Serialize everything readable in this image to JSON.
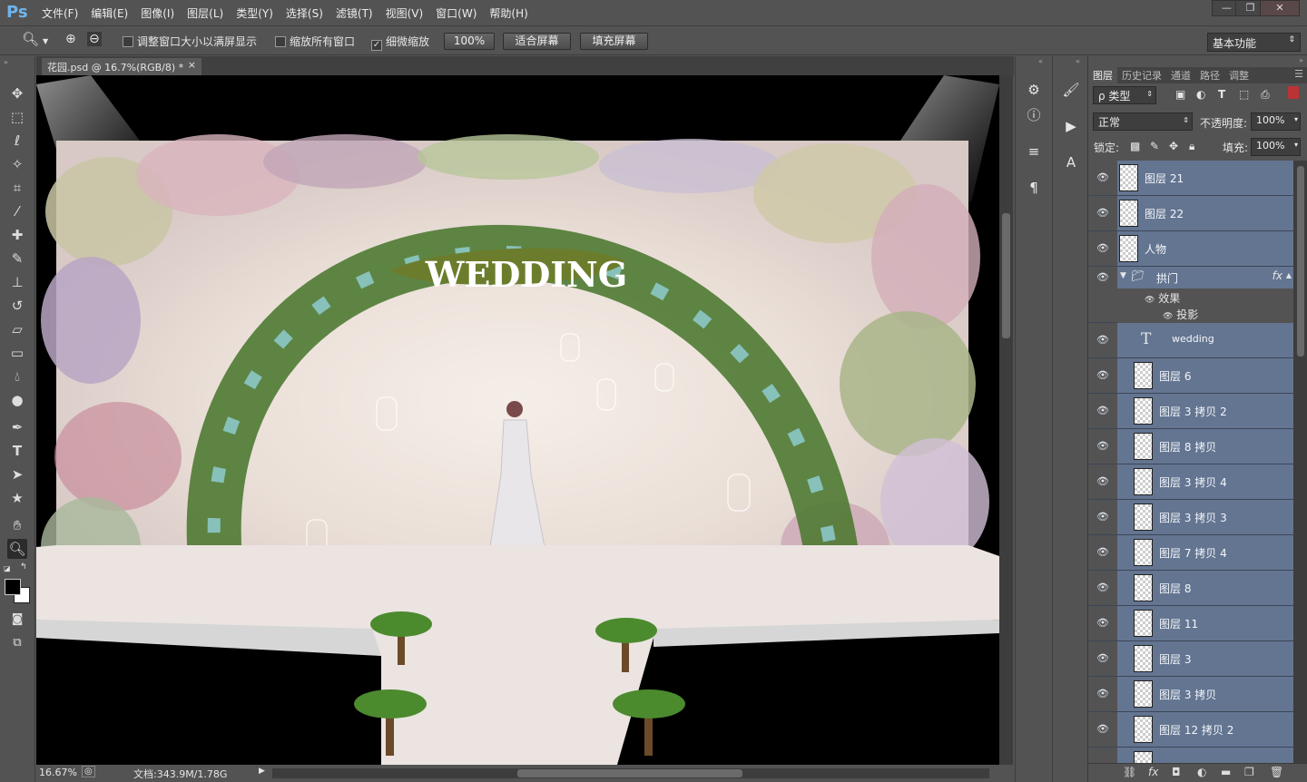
{
  "app": {
    "logo": "Ps"
  },
  "menu": [
    "文件(F)",
    "编辑(E)",
    "图像(I)",
    "图层(L)",
    "类型(Y)",
    "选择(S)",
    "滤镜(T)",
    "视图(V)",
    "窗口(W)",
    "帮助(H)"
  ],
  "window_controls": [
    "—",
    "❐",
    "✕"
  ],
  "options": {
    "resize_windows": "调整窗口大小以满屏显示",
    "zoom_all": "缩放所有窗口",
    "scrubby_zoom": "细微缩放",
    "zoom_value": "100%",
    "fit_screen": "适合屏幕",
    "fill_screen": "填充屏幕",
    "workspace": "基本功能"
  },
  "document": {
    "tab_title": "花园.psd @ 16.7%(RGB/8) *",
    "close": "×",
    "canvas_title": "WEDDING"
  },
  "status": {
    "zoom": "16.67%",
    "doc_info": "文档:343.9M/1.78G"
  },
  "panel": {
    "tabs": [
      "图层",
      "历史记录",
      "通道",
      "路径",
      "调整"
    ],
    "filter_kind": "ρ 类型",
    "blend_mode": "正常",
    "opacity_label": "不透明度:",
    "opacity_value": "100%",
    "lock_label": "锁定:",
    "fill_label": "填充:",
    "fill_value": "100%",
    "effects_label": "效果",
    "drop_shadow_label": "投影",
    "group_fx": "fx",
    "layers": [
      {
        "name": "图层 21",
        "kind": "pixel",
        "indent": 0
      },
      {
        "name": "图层 22",
        "kind": "pixel",
        "indent": 0
      },
      {
        "name": "人物",
        "kind": "pixel",
        "indent": 0
      },
      {
        "name": "拱门",
        "kind": "group",
        "indent": 0
      },
      {
        "name": "wedding",
        "kind": "text",
        "indent": 1
      },
      {
        "name": "图层 6",
        "kind": "pixel",
        "indent": 1
      },
      {
        "name": "图层 3 拷贝 2",
        "kind": "pixel",
        "indent": 1
      },
      {
        "name": "图层 8 拷贝",
        "kind": "pixel",
        "indent": 1
      },
      {
        "name": "图层 3 拷贝 4",
        "kind": "pixel",
        "indent": 1
      },
      {
        "name": "图层 3 拷贝 3",
        "kind": "pixel",
        "indent": 1
      },
      {
        "name": "图层 7 拷贝 4",
        "kind": "pixel",
        "indent": 1
      },
      {
        "name": "图层 8",
        "kind": "pixel",
        "indent": 1
      },
      {
        "name": "图层 11",
        "kind": "pixel",
        "indent": 1
      },
      {
        "name": "图层 3",
        "kind": "pixel",
        "indent": 1
      },
      {
        "name": "图层 3 拷贝",
        "kind": "pixel",
        "indent": 1
      },
      {
        "name": "图层 12 拷贝 2",
        "kind": "pixel",
        "indent": 1
      }
    ]
  },
  "colors": {
    "chrome": "#535353",
    "selected_layer": "#637591",
    "logo": "#6fb4ee"
  }
}
